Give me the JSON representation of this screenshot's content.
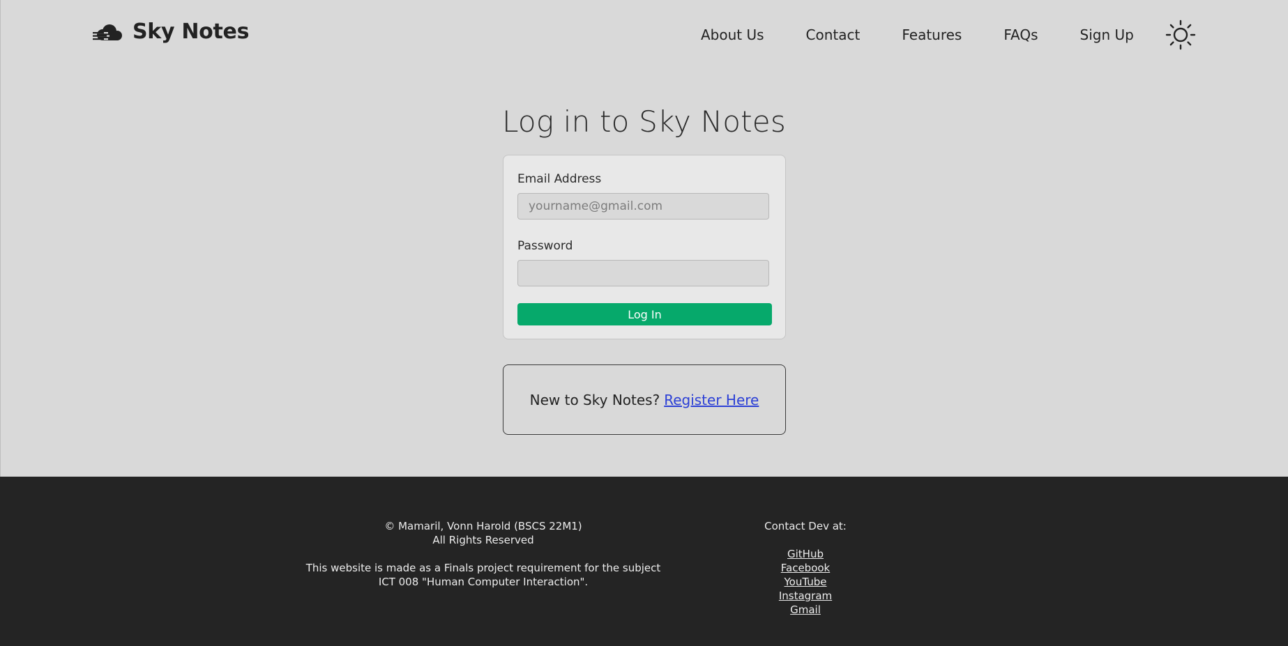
{
  "header": {
    "brand": "Sky Notes",
    "nav": [
      "About Us",
      "Contact",
      "Features",
      "FAQs",
      "Sign Up"
    ]
  },
  "main": {
    "title": "Log in to Sky Notes",
    "email_label": "Email Address",
    "email_placeholder": "yourname@gmail.com",
    "password_label": "Password",
    "login_button": "Log In",
    "register_prompt": "New to Sky Notes?",
    "register_link": "Register Here"
  },
  "footer": {
    "copyright": "© Mamaril, Vonn Harold (BSCS 22M1)",
    "rights": "All Rights Reserved",
    "note": "This website is made as a Finals project requirement for the subject ICT 008 \"Human Computer Interaction\".",
    "contact_heading": "Contact Dev at:",
    "links": [
      "GitHub",
      "Facebook",
      "YouTube",
      "Instagram",
      "Gmail"
    ]
  },
  "colors": {
    "background": "#d9d9d9",
    "accent": "#06a96b",
    "link": "#2b3fd6",
    "footer_bg": "#242424"
  }
}
